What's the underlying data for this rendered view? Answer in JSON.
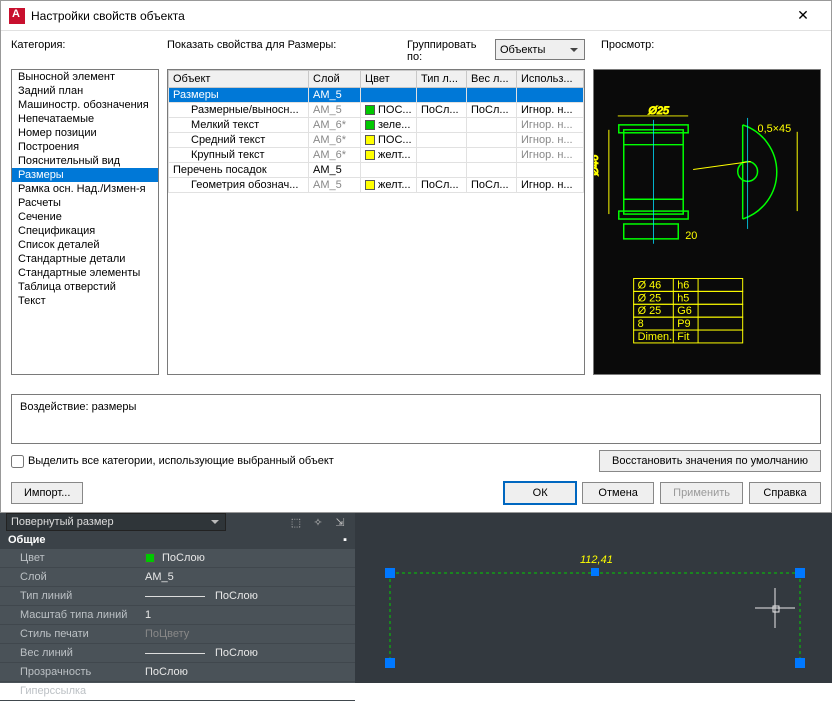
{
  "dialog": {
    "title": "Настройки свойств объекта",
    "category_label": "Категория:",
    "show_props_label": "Показать свойства для Размеры:",
    "group_by_label": "Группировать по:",
    "group_by_value": "Объекты",
    "preview_label": "Просмотр:",
    "categories": [
      "Выносной элемент",
      "Задний план",
      "Машиностр. обозначения",
      "Непечатаемые",
      "Номер позиции",
      "Построения",
      "Пояснительный вид",
      "Размеры",
      "Рамка осн. Над./Измен-я",
      "Расчеты",
      "Сечение",
      "Спецификация",
      "Список деталей",
      "Стандартные детали",
      "Стандартные элементы",
      "Таблица отверстий",
      "Текст"
    ],
    "selected_category_index": 7,
    "table": {
      "headers": [
        "Объект",
        "Слой",
        "Цвет",
        "Тип л...",
        "Вес л...",
        "Использ..."
      ],
      "rows": [
        {
          "indent": 0,
          "object": "Размеры",
          "layer": "AM_5",
          "color": "",
          "ltype": "",
          "lweight": "",
          "use": "",
          "selected": true
        },
        {
          "indent": 1,
          "object": "Размерные/выносн...",
          "layer": "AM_5",
          "layer_dim": true,
          "color": "ПОС...",
          "chip": "green",
          "ltype": "ПоСл...",
          "lweight": "ПоСл...",
          "use": "Игнор. н..."
        },
        {
          "indent": 1,
          "object": "Мелкий текст",
          "layer": "AM_6*",
          "layer_dim": true,
          "color": "зеле...",
          "chip": "green",
          "ltype": "",
          "lweight": "",
          "use": "Игнор. н...",
          "use_dim": true
        },
        {
          "indent": 1,
          "object": "Средний текст",
          "layer": "AM_6*",
          "layer_dim": true,
          "color": "ПОС...",
          "chip": "yellow",
          "ltype": "",
          "lweight": "",
          "use": "Игнор. н...",
          "use_dim": true
        },
        {
          "indent": 1,
          "object": "Крупный текст",
          "layer": "AM_6*",
          "layer_dim": true,
          "color": "желт...",
          "chip": "yellow",
          "ltype": "",
          "lweight": "",
          "use": "Игнор. н...",
          "use_dim": true
        },
        {
          "indent": 0,
          "object": "Перечень посадок",
          "layer": "AM_5",
          "color": "",
          "ltype": "",
          "lweight": "",
          "use": ""
        },
        {
          "indent": 1,
          "object": "Геометрия обознач...",
          "layer": "AM_5",
          "layer_dim": true,
          "color": "желт...",
          "chip": "yellow",
          "ltype": "ПоСл...",
          "lweight": "ПоСл...",
          "use": "Игнор. н..."
        }
      ]
    },
    "effect_label": "Воздействие: размеры",
    "checkbox_label": "Выделить все категории, использующие выбранный объект",
    "restore_label": "Восстановить значения по умолчанию",
    "import_label": "Импорт...",
    "ok_label": "ОК",
    "cancel_label": "Отмена",
    "apply_label": "Применить",
    "help_label": "Справка"
  },
  "preview_table": {
    "rows": [
      [
        "Ø 46",
        "h6",
        ""
      ],
      [
        "Ø 25",
        "h5",
        ""
      ],
      [
        "Ø 25",
        "G6",
        ""
      ],
      [
        "8",
        "P9",
        ""
      ],
      [
        "Dimen.",
        "Fit",
        ""
      ]
    ]
  },
  "props_palette": {
    "object_type": "Повернутый размер",
    "group": "Общие",
    "rows": [
      {
        "name": "Цвет",
        "value": "ПоСлою",
        "chip": "green"
      },
      {
        "name": "Слой",
        "value": "AM_5"
      },
      {
        "name": "Тип линий",
        "value": "ПоСлою",
        "line": true
      },
      {
        "name": "Масштаб типа линий",
        "value": "1"
      },
      {
        "name": "Стиль печати",
        "value": "ПоЦвету",
        "dim": true
      },
      {
        "name": "Вес линий",
        "value": "ПоСлою",
        "line": true
      },
      {
        "name": "Прозрачность",
        "value": "ПоСлою"
      },
      {
        "name": "Гиперссылка",
        "value": ""
      }
    ]
  },
  "canvas": {
    "dim_text": "112,41"
  }
}
